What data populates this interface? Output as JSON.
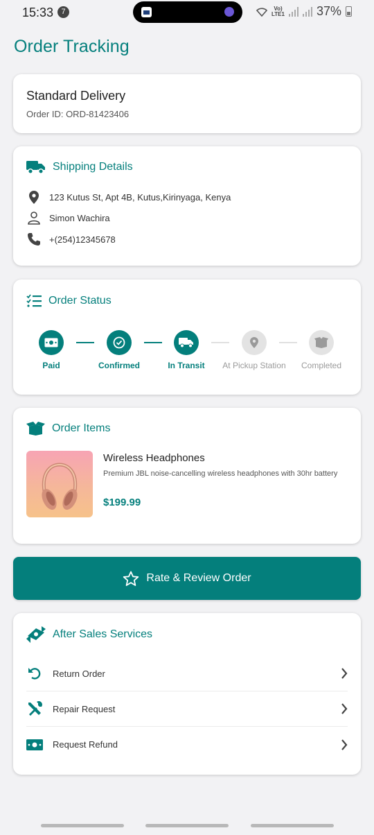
{
  "status_bar": {
    "time": "15:33",
    "notification_count": "7",
    "network_top": "Vo)",
    "network_bottom": "LTE1",
    "battery": "37%"
  },
  "page": {
    "title": "Order Tracking"
  },
  "delivery": {
    "title": "Standard Delivery",
    "order_id": "Order ID: ORD-81423406"
  },
  "shipping": {
    "heading": "Shipping Details",
    "address": "123 Kutus St, Apt 4B, Kutus,Kirinyaga, Kenya",
    "name": "Simon Wachira",
    "phone": "+(254)12345678"
  },
  "order_status": {
    "heading": "Order Status",
    "steps": [
      {
        "label": "Paid",
        "done": true,
        "icon": "money-icon"
      },
      {
        "label": "Confirmed",
        "done": true,
        "icon": "check-circle-icon"
      },
      {
        "label": "In Transit",
        "done": true,
        "icon": "truck-icon"
      },
      {
        "label": "At Pickup Station",
        "done": false,
        "icon": "location-pin-icon"
      },
      {
        "label": "Completed",
        "done": false,
        "icon": "box-icon"
      }
    ]
  },
  "order_items": {
    "heading": "Order Items",
    "items": [
      {
        "name": "Wireless Headphones",
        "description": "Premium JBL noise-cancelling wireless headphones with 30hr battery",
        "price": "$199.99"
      }
    ]
  },
  "rate_button": {
    "label": "Rate & Review Order"
  },
  "after_sales": {
    "heading": "After Sales Services",
    "services": [
      {
        "label": "Return Order",
        "icon": "undo-icon"
      },
      {
        "label": "Repair Request",
        "icon": "tools-icon"
      },
      {
        "label": "Request Refund",
        "icon": "money-icon"
      }
    ]
  },
  "colors": {
    "accent": "#047f7c",
    "inactive": "#e3e3e3",
    "background": "#f2f2f4"
  }
}
